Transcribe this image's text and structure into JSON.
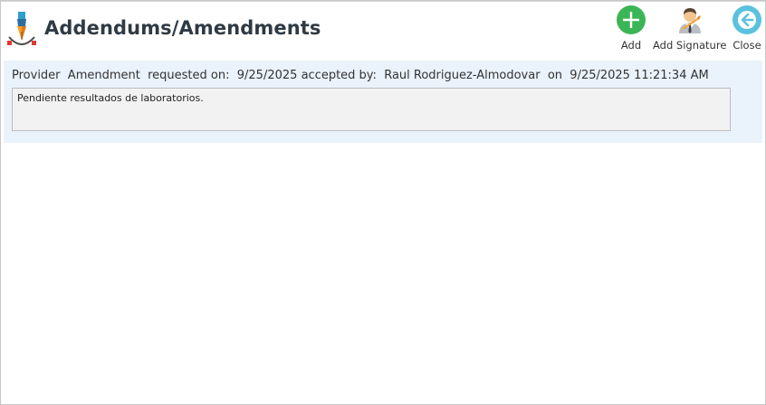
{
  "header": {
    "title": "Addendums/Amendments",
    "app_icon": "pen-nib-icon"
  },
  "toolbar": {
    "add_label": "Add",
    "add_signature_label": "Add Signature",
    "close_label": "Close",
    "add_icon": "plus-circle-icon",
    "add_signature_icon": "user-signature-icon",
    "close_icon": "arrow-left-circle-icon",
    "colors": {
      "add": "#3cb556",
      "close": "#5bc2de"
    }
  },
  "amendment": {
    "role": "Provider",
    "type": "Amendment",
    "requested_label": "requested on:",
    "requested_date": "9/25/2025",
    "accepted_label": "accepted by:",
    "accepted_by": "Raul Rodriguez-Almodovar",
    "on_label": "on",
    "accepted_datetime": "9/25/2025 11:21:34 AM",
    "note": "Pendiente resultados de laboratorios."
  },
  "colors": {
    "entry_background": "#eaf2fb",
    "note_background": "#f2f2f2"
  }
}
